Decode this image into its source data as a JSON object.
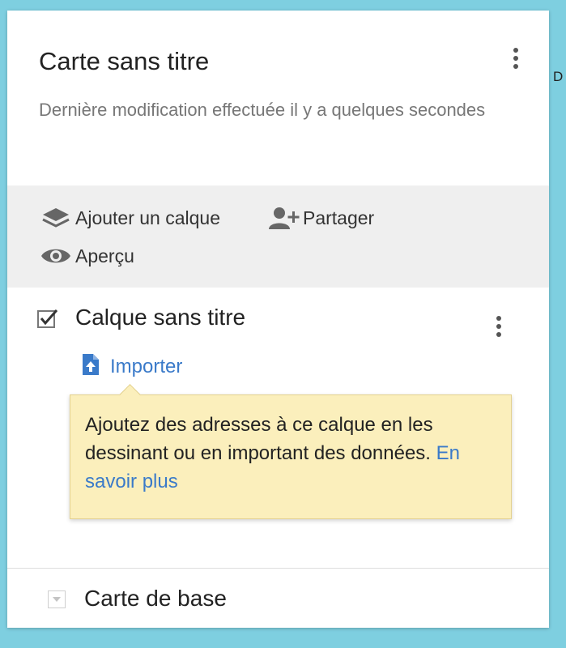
{
  "edge_text": "D",
  "map": {
    "title": "Carte sans titre",
    "subtitle": "Dernière modification effectuée il y a quelques secondes"
  },
  "toolbar": {
    "add_layer_label": "Ajouter un calque",
    "add_layer_icon": "layers-icon",
    "share_label": "Partager",
    "share_icon": "add-person-icon",
    "preview_label": "Aperçu",
    "preview_icon": "eye-icon"
  },
  "layer": {
    "title": "Calque sans titre",
    "checked": true,
    "import_label": "Importer",
    "import_icon": "upload-file-icon"
  },
  "tooltip": {
    "text": "Ajoutez des adresses à ce calque en les dessinant ou en important des données.",
    "link_label": "En savoir plus"
  },
  "basemap": {
    "label": "Carte de base"
  },
  "colors": {
    "background": "#7ecfe0",
    "panel": "#ffffff",
    "toolbar": "#efefef",
    "link": "#3a7ac9",
    "tooltip_bg": "#fbefbc",
    "icon": "#666666"
  }
}
